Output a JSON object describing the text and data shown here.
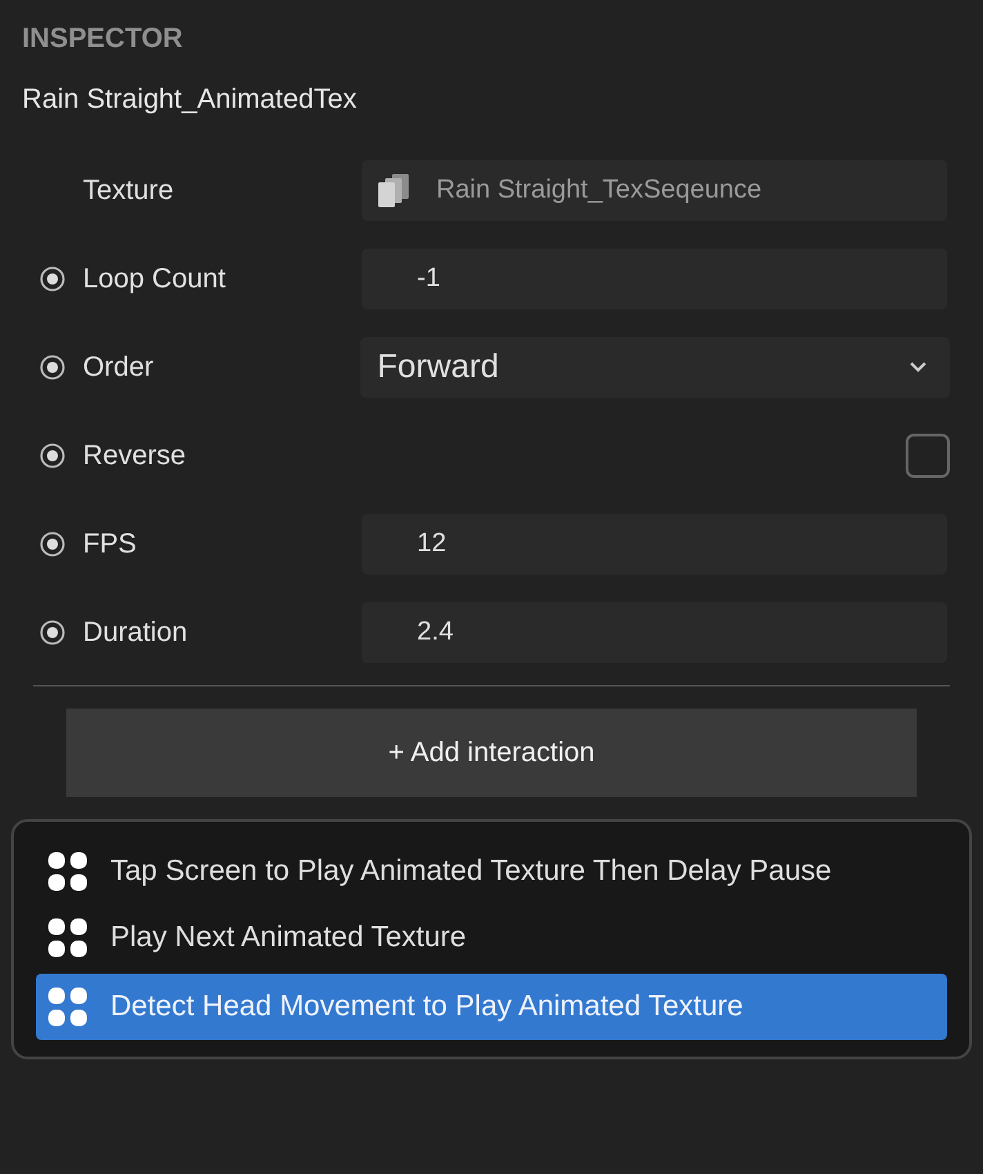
{
  "panel": {
    "title": "INSPECTOR",
    "object_name": "Rain Straight_AnimatedTex"
  },
  "properties": [
    {
      "kind": "asset",
      "label": "Texture",
      "keyable": false,
      "value": "Rain Straight_TexSeqeunce"
    },
    {
      "kind": "field",
      "label": "Loop Count",
      "keyable": true,
      "value": "-1"
    },
    {
      "kind": "select",
      "label": "Order",
      "keyable": true,
      "value": "Forward"
    },
    {
      "kind": "checkbox",
      "label": "Reverse",
      "keyable": true,
      "checked": false
    },
    {
      "kind": "field",
      "label": "FPS",
      "keyable": true,
      "value": "12"
    },
    {
      "kind": "field",
      "label": "Duration",
      "keyable": true,
      "value": "2.4"
    }
  ],
  "add_button": {
    "icon": "+",
    "label": "Add interaction"
  },
  "menu": [
    {
      "label": "Tap Screen to Play Animated Texture Then Delay Pause",
      "selected": false
    },
    {
      "label": "Play Next Animated Texture",
      "selected": false
    },
    {
      "label": "Detect Head Movement to Play Animated Texture",
      "selected": true
    }
  ]
}
